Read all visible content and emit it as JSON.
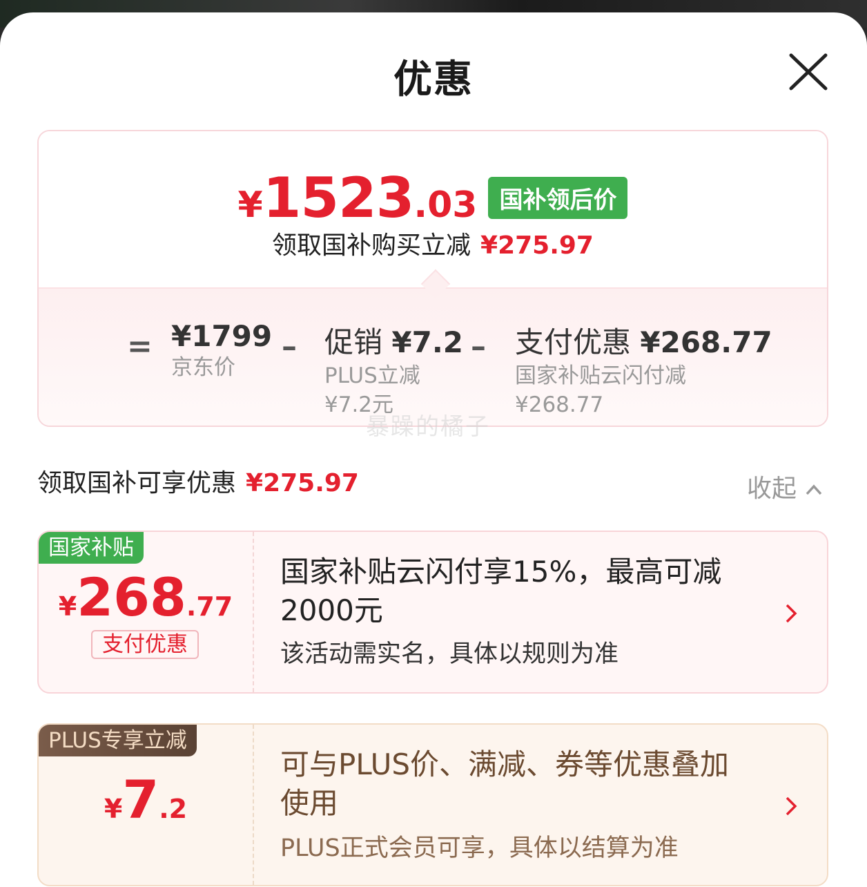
{
  "sheet": {
    "title": "优惠"
  },
  "summary": {
    "yen": "¥",
    "price_int": "1523",
    "price_dec": ".03",
    "badge": "国补领后价",
    "save_text": "领取国补购买立减",
    "save_amount": "¥275.97",
    "breakdown": [
      {
        "main_label": "",
        "main_amount": "¥1799",
        "sub1": "京东价",
        "sub2": ""
      },
      {
        "main_label": "促销",
        "main_amount": "¥7.2",
        "sub1": "PLUS立减",
        "sub2": "¥7.2元"
      },
      {
        "main_label": "支付优惠",
        "main_amount": "¥268.77",
        "sub1": "国家补贴云闪付减",
        "sub2": "¥268.77"
      }
    ],
    "ops": [
      "=",
      "–",
      "–"
    ]
  },
  "watermark": "暴躁的橘子",
  "section": {
    "title": "领取国补可享优惠",
    "amount": "¥275.97",
    "collapse_label": "收起"
  },
  "coupons": [
    {
      "tag": "国家补贴",
      "yen": "¥",
      "amount_int": "268",
      "amount_dec": ".77",
      "sub_tag": "支付优惠",
      "title": "国家补贴云闪付享15%，最高可减2000元",
      "desc": "该活动需实名，具体以规则为准"
    },
    {
      "tag": "PLUS专享立减",
      "yen": "¥",
      "amount_int": "7",
      "amount_dec": ".2",
      "title": "可与PLUS价、满减、券等优惠叠加使用",
      "desc": "PLUS正式会员可享，具体以结算为准"
    }
  ],
  "colors": {
    "accent_red": "#e4202e",
    "green_badge": "#3fae4f",
    "plus_brown": "#5a4234"
  }
}
